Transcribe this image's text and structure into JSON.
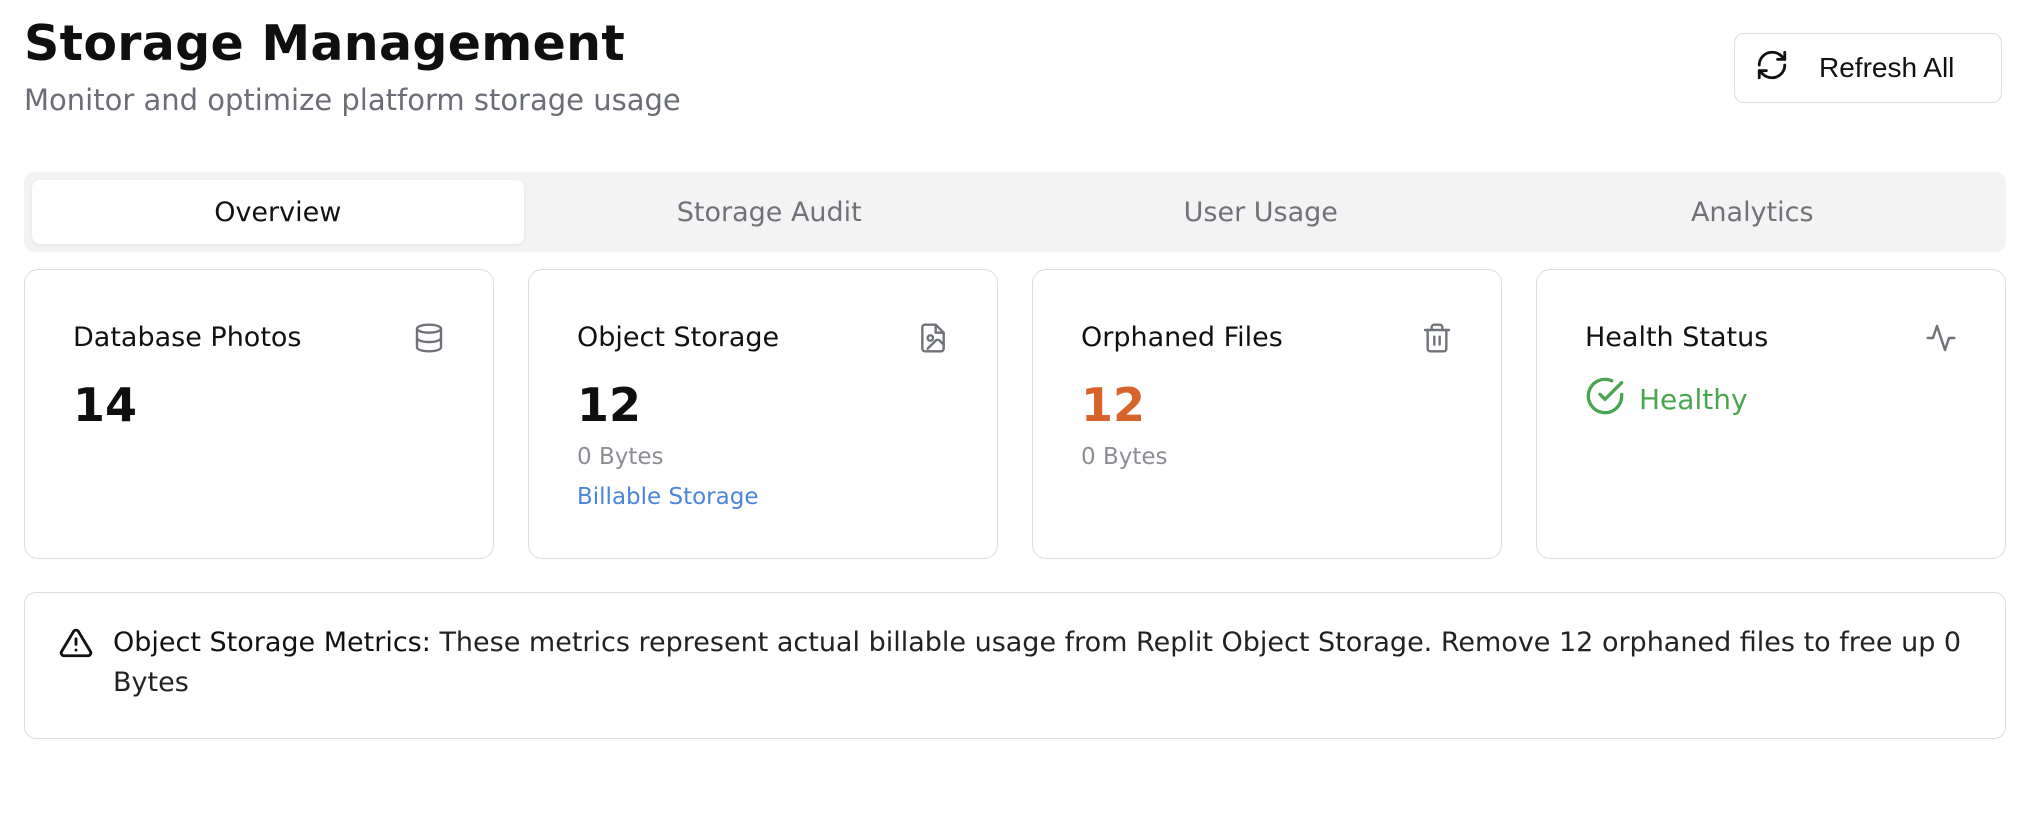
{
  "header": {
    "title": "Storage Management",
    "subtitle": "Monitor and optimize platform storage usage",
    "refresh_label": "Refresh All",
    "refresh_icon": "refresh-icon"
  },
  "tabs": [
    {
      "label": "Overview",
      "active": true
    },
    {
      "label": "Storage Audit",
      "active": false
    },
    {
      "label": "User Usage",
      "active": false
    },
    {
      "label": "Analytics",
      "active": false
    }
  ],
  "cards": {
    "database_photos": {
      "title": "Database Photos",
      "value": "14",
      "icon": "database-icon"
    },
    "object_storage": {
      "title": "Object Storage",
      "value": "12",
      "size": "0 Bytes",
      "link": "Billable Storage",
      "icon": "file-image-icon"
    },
    "orphaned_files": {
      "title": "Orphaned Files",
      "value": "12",
      "size": "0 Bytes",
      "icon": "trash-icon"
    },
    "health_status": {
      "title": "Health Status",
      "status": "Healthy",
      "icon": "activity-icon"
    }
  },
  "alert": {
    "heading": "Object Storage Metrics:",
    "message": "These metrics represent actual billable usage from Replit Object Storage. Remove 12 orphaned files to free up 0 Bytes",
    "icon": "warning-icon"
  },
  "colors": {
    "accent_orange": "#d9642b",
    "link_blue": "#4b85dc",
    "healthy_green": "#4aa54f"
  }
}
